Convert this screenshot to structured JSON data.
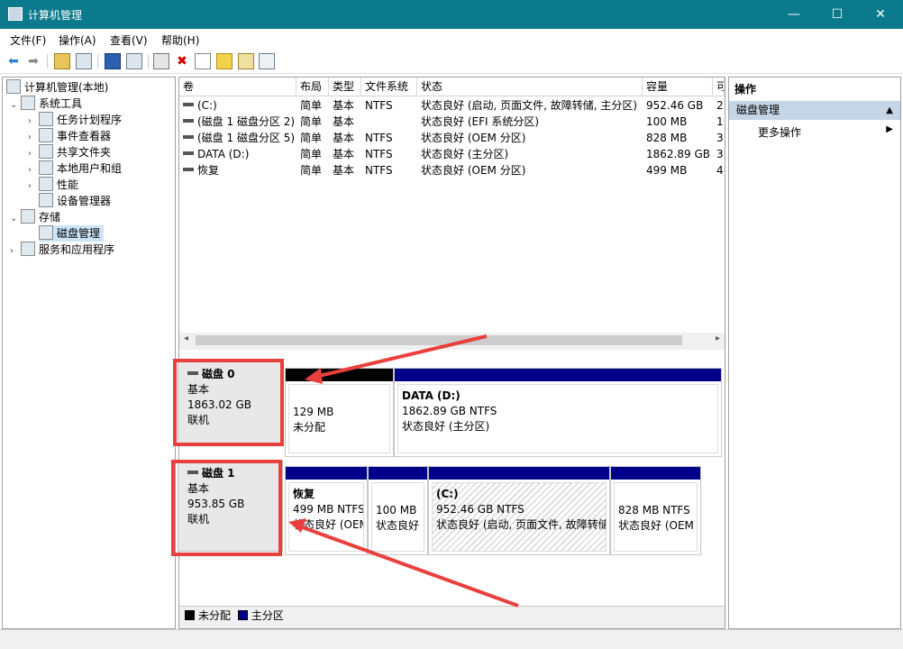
{
  "window": {
    "title": "计算机管理",
    "minimize": "—",
    "maximize": "☐",
    "close": "✕"
  },
  "menu": {
    "file": "文件(F)",
    "action": "操作(A)",
    "view": "查看(V)",
    "help": "帮助(H)"
  },
  "toolbar": {
    "back": "⬅",
    "forward": "➡",
    "delete": "✖",
    "icons": [
      "back-icon",
      "forward-icon",
      "up-icon",
      "show-hide-tree-icon",
      "help-icon",
      "properties-icon",
      "connect-icon",
      "delete-icon",
      "check-icon",
      "export-icon",
      "search-icon",
      "list-icon"
    ]
  },
  "tree": {
    "root": "计算机管理(本地)",
    "system_tools": "系统工具",
    "task_scheduler": "任务计划程序",
    "event_viewer": "事件查看器",
    "shared_folders": "共享文件夹",
    "local_users": "本地用户和组",
    "performance": "性能",
    "device_manager": "设备管理器",
    "storage": "存储",
    "disk_management": "磁盘管理",
    "services": "服务和应用程序"
  },
  "table": {
    "headers": [
      "卷",
      "布局",
      "类型",
      "文件系统",
      "状态",
      "容量",
      "可"
    ],
    "rows": [
      [
        "(C:)",
        "简单",
        "基本",
        "NTFS",
        "状态良好 (启动, 页面文件, 故障转储, 主分区)",
        "952.46 GB",
        "2"
      ],
      [
        "(磁盘 1 磁盘分区 2)",
        "简单",
        "基本",
        "",
        "状态良好 (EFI 系统分区)",
        "100 MB",
        "1"
      ],
      [
        "(磁盘 1 磁盘分区 5)",
        "简单",
        "基本",
        "NTFS",
        "状态良好 (OEM 分区)",
        "828 MB",
        "3"
      ],
      [
        "DATA (D:)",
        "简单",
        "基本",
        "NTFS",
        "状态良好 (主分区)",
        "1862.89 GB",
        "3"
      ],
      [
        "恢复",
        "简单",
        "基本",
        "NTFS",
        "状态良好 (OEM 分区)",
        "499 MB",
        "4"
      ]
    ]
  },
  "disks": {
    "disk0": {
      "name": "磁盘 0",
      "type": "基本",
      "size": "1863.02 GB",
      "status": "联机",
      "p1": {
        "line1": "129 MB",
        "line2": "未分配"
      },
      "p2": {
        "title": "DATA  (D:)",
        "line1": "1862.89 GB NTFS",
        "line2": "状态良好 (主分区)"
      }
    },
    "disk1": {
      "name": "磁盘 1",
      "type": "基本",
      "size": "953.85 GB",
      "status": "联机",
      "p1": {
        "title": "恢复",
        "line1": "499 MB NTFS",
        "line2": "状态良好 (OEM 分区)"
      },
      "p2": {
        "line1": "100 MB",
        "line2": "状态良好 (EFI 系统分区)"
      },
      "p3": {
        "title": "(C:)",
        "line1": "952.46 GB NTFS",
        "line2": "状态良好 (启动, 页面文件, 故障转储, 主分区)"
      },
      "p4": {
        "line1": "828 MB NTFS",
        "line2": "状态良好 (OEM 分区)"
      }
    }
  },
  "legend": {
    "unallocated": "未分配",
    "primary": "主分区"
  },
  "actions": {
    "header": "操作",
    "section": "磁盘管理",
    "more": "更多操作"
  },
  "colors": {
    "titlebar": "#0b7a8c",
    "primary_partition": "#00008b",
    "unallocated": "#000000",
    "highlight": "#e9403e"
  }
}
